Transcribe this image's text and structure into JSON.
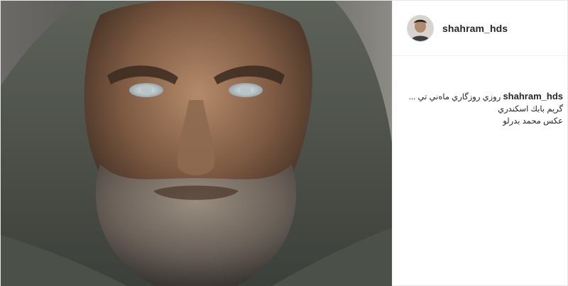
{
  "post": {
    "username": "shahram_hds",
    "caption": {
      "username": "shahram_hds",
      "line1_text": "روزي روزگاري ماه‌ني تي ...",
      "line2": "گريم بابك اسكندري",
      "line3": "عكس محمد بدرلو"
    }
  },
  "icons": {
    "avatar": "profile-photo",
    "main_image": "photo-bearded-man-in-wool-hood"
  },
  "colors": {
    "text": "#262626",
    "border": "#efefef",
    "background": "#ffffff"
  }
}
